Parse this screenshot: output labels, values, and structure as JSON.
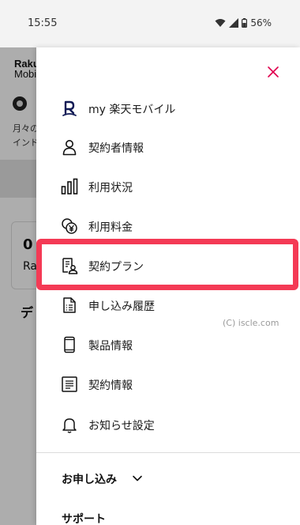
{
  "status_bar": {
    "time": "15:55",
    "battery": "56%"
  },
  "background": {
    "logo_line1": "Raku",
    "logo_line2": "Mobil",
    "text_line1": "月々の",
    "text_line2": "インド",
    "card_value": "0",
    "card_sub": "Ra",
    "section": "デ"
  },
  "drawer": {
    "close_icon": "close-icon",
    "accent_color": "#e0004d",
    "highlight_color": "#f43a55",
    "items": [
      {
        "label": "my 楽天モバイル",
        "icon": "rakuten-r-icon"
      },
      {
        "label": "契約者情報",
        "icon": "person-icon"
      },
      {
        "label": "利用状況",
        "icon": "bar-chart-icon"
      },
      {
        "label": "利用料金",
        "icon": "yen-coins-icon"
      },
      {
        "label": "契約プラン",
        "icon": "plan-document-icon"
      },
      {
        "label": "申し込み履歴",
        "icon": "history-document-icon"
      },
      {
        "label": "製品情報",
        "icon": "smartphone-icon"
      },
      {
        "label": "契約情報",
        "icon": "contract-icon"
      },
      {
        "label": "お知らせ設定",
        "icon": "bell-icon"
      }
    ],
    "watermark": "(C) iscle.com",
    "section_apply": "お申し込み",
    "section_support": "サポート"
  }
}
